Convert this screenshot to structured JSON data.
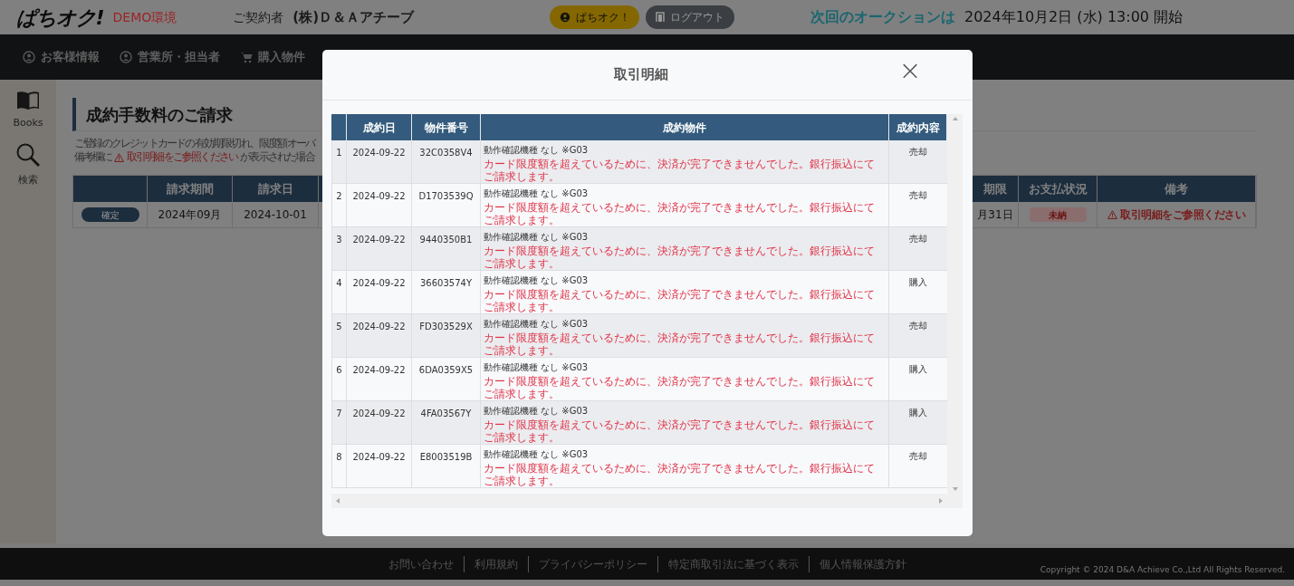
{
  "header": {
    "logo": "ぱちオク!",
    "env_badge": "DEMO環境",
    "contract_label": "ご契約者",
    "contract_name": "(株)Ｄ＆Ａアチーブ",
    "member_button": "ぱちオク！",
    "logout_button": "ログアウト",
    "next_label": "次回のオークションは",
    "next_date": "2024年10月2日 (水) 13:00 開始"
  },
  "nav": [
    {
      "label": "お客様情報"
    },
    {
      "label": "営業所・担当者"
    },
    {
      "label": "購入物件"
    }
  ],
  "sidebar": [
    {
      "label": "Books"
    },
    {
      "label": "検索"
    }
  ],
  "page": {
    "title": "成約手数料のご請求",
    "notice_line": "ご登録のクレジットカードの有効期限切れ、限度額オーバ",
    "notice_prefix": "備考欄に",
    "notice_link": "取引明細をご参照ください",
    "notice_suffix": "が表示された場合",
    "columns": [
      "",
      "請求期間",
      "請求日",
      "",
      "期限",
      "お支払状況",
      "備考"
    ],
    "rows": [
      {
        "status": "確定",
        "period": "2024年09月",
        "date": "2024-10-01",
        "hidden": "",
        "deadline": "月31日",
        "payment": "未納",
        "note": "取引明細をご参照ください"
      }
    ]
  },
  "modal": {
    "title": "取引明細",
    "close": "×",
    "columns": [
      "",
      "成約日",
      "物件番号",
      "成約物件",
      "成約内容"
    ],
    "rows": [
      {
        "no": "1",
        "date": "2024-09-22",
        "item_no": "32C0358V4",
        "item": "動作確認機種 なし ※G03",
        "message": "カード限度額を超えているために、決済が完了できませんでした。銀行振込にてご請求します。",
        "type": "売却"
      },
      {
        "no": "2",
        "date": "2024-09-22",
        "item_no": "D1703539Q",
        "item": "動作確認機種 なし ※G03",
        "message": "カード限度額を超えているために、決済が完了できませんでした。銀行振込にてご請求します。",
        "type": "売却"
      },
      {
        "no": "3",
        "date": "2024-09-22",
        "item_no": "9440350B1",
        "item": "動作確認機種 なし ※G03",
        "message": "カード限度額を超えているために、決済が完了できませんでした。銀行振込にてご請求します。",
        "type": "売却"
      },
      {
        "no": "4",
        "date": "2024-09-22",
        "item_no": "36603574Y",
        "item": "動作確認機種 なし ※G03",
        "message": "カード限度額を超えているために、決済が完了できませんでした。銀行振込にてご請求します。",
        "type": "購入"
      },
      {
        "no": "5",
        "date": "2024-09-22",
        "item_no": "FD303529X",
        "item": "動作確認機種 なし ※G03",
        "message": "カード限度額を超えているために、決済が完了できませんでした。銀行振込にてご請求します。",
        "type": "売却"
      },
      {
        "no": "6",
        "date": "2024-09-22",
        "item_no": "6DA0359X5",
        "item": "動作確認機種 なし ※G03",
        "message": "カード限度額を超えているために、決済が完了できませんでした。銀行振込にてご請求します。",
        "type": "購入"
      },
      {
        "no": "7",
        "date": "2024-09-22",
        "item_no": "4FA03567Y",
        "item": "動作確認機種 なし ※G03",
        "message": "カード限度額を超えているために、決済が完了できませんでした。銀行振込にてご請求します。",
        "type": "購入"
      },
      {
        "no": "8",
        "date": "2024-09-22",
        "item_no": "E8003519B",
        "item": "動作確認機種 なし ※G03",
        "message": "カード限度額を超えているために、決済が完了できませんでした。銀行振込にてご請求します。",
        "type": "売却"
      }
    ]
  },
  "footer": {
    "links": [
      "お問い合わせ",
      "利用規約",
      "プライバシーポリシー",
      "特定商取引法に基づく表示",
      "個人情報保護方針"
    ],
    "copyright": "Copyright © 2024 D&A Achieve Co.,Ltd All Rights Reserved."
  }
}
